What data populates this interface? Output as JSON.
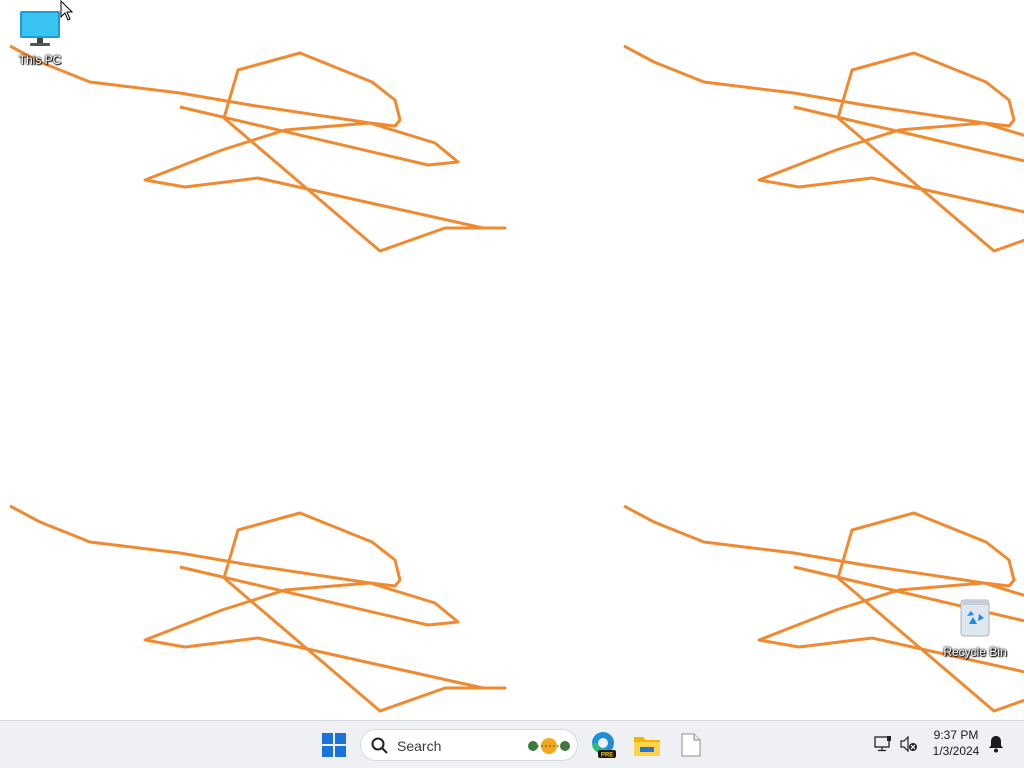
{
  "desktop": {
    "icons": [
      {
        "label": "This PC"
      },
      {
        "label": "Recycle Bin"
      }
    ]
  },
  "taskbar": {
    "search_placeholder": "Search",
    "pinned": [
      {
        "name": "edge-icon"
      },
      {
        "name": "file-explorer-icon"
      },
      {
        "name": "notepad-icon"
      }
    ],
    "pre_badge": "PRE"
  },
  "tray": {
    "time": "9:37 PM",
    "date": "1/3/2024"
  },
  "colors": {
    "wallpaper_stroke": "#f08a30",
    "taskbar_bg": "#eef0f4",
    "start_blue": "#1a73d9"
  }
}
